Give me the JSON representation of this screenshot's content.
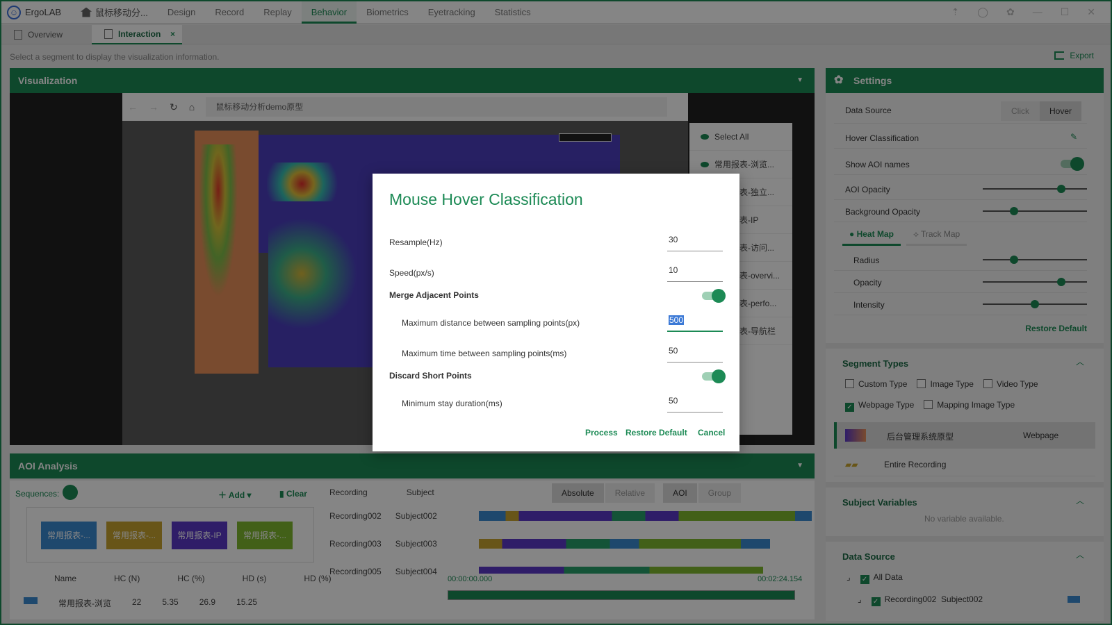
{
  "app": {
    "name": "ErgoLAB",
    "project": "鼠标移动分..."
  },
  "nav": [
    "Design",
    "Record",
    "Replay",
    "Behavior",
    "Biometrics",
    "Eyetracking",
    "Statistics"
  ],
  "subtabs": {
    "overview": "Overview",
    "interaction": "Interaction",
    "close": "×"
  },
  "hint": "Select a segment to display the visualization information.",
  "export": "Export",
  "visualization": {
    "title": "Visualization",
    "browser_url": "鼠标移动分析demo原型",
    "segments": [
      "Select All",
      "常用报表-浏览...",
      "常用报表-独立...",
      "常用报表-IP",
      "常用报表-访问...",
      "常用报表-overvi...",
      "常用报表-perfo...",
      "常用报表-导航栏"
    ]
  },
  "aoi": {
    "title": "AOI Analysis",
    "sequences": "Sequences:",
    "add": "Add",
    "clear": "Clear",
    "seq_items": [
      "常用报表-...",
      "常用报表-...",
      "常用报表-IP",
      "常用报表-..."
    ],
    "columns": [
      "Name",
      "HC (N)",
      "HC (%)",
      "HD (s)",
      "HD (%)"
    ],
    "row": [
      "常用报表-浏览",
      "22",
      "5.35",
      "26.9",
      "15.25"
    ],
    "rec_headers": [
      "Recording",
      "Subject"
    ],
    "modes": [
      "Absolute",
      "Relative",
      "AOI",
      "Group"
    ],
    "recordings": [
      [
        "Recording002",
        "Subject002"
      ],
      [
        "Recording003",
        "Subject003"
      ],
      [
        "Recording005",
        "Subject004"
      ]
    ],
    "time_start": "00:00:00.000",
    "time_end": "00:02:24.154"
  },
  "settings": {
    "title": "Settings",
    "data_source": "Data Source",
    "click": "Click",
    "hover": "Hover",
    "hover_class": "Hover Classification",
    "show_aoi": "Show AOI names",
    "aoi_opacity": "AOI Opacity",
    "aoi_opacity_value": 0.75,
    "bg_opacity": "Background Opacity",
    "bg_opacity_value": 0.3,
    "heat_map": "Heat Map",
    "track_map": "Track Map",
    "radius": "Radius",
    "radius_value": 0.3,
    "opacity": "Opacity",
    "opacity_value": 0.75,
    "intensity": "Intensity",
    "intensity_value": 0.5,
    "restore": "Restore Default",
    "segment_types": "Segment Types",
    "types": [
      "Custom Type",
      "Image Type",
      "Video Type",
      "Webpage Type",
      "Mapping Image Type"
    ],
    "seg_row1": [
      "后台管理系统原型",
      "Webpage"
    ],
    "seg_row2": "Entire Recording",
    "subject_vars": "Subject Variables",
    "no_var": "No variable available.",
    "ds_title": "Data Source",
    "all_data": "All Data",
    "rec_row": [
      "Recording002",
      "Subject002"
    ]
  },
  "modal": {
    "title": "Mouse Hover Classification",
    "resample": "Resample(Hz)",
    "resample_val": "30",
    "speed": "Speed(px/s)",
    "speed_val": "10",
    "merge": "Merge Adjacent Points",
    "maxdist": "Maximum distance between sampling points(px)",
    "maxdist_val": "500",
    "maxtime": "Maximum time between sampling points(ms)",
    "maxtime_val": "50",
    "discard": "Discard Short Points",
    "minstay": "Minimum stay duration(ms)",
    "minstay_val": "50",
    "process": "Process",
    "restore": "Restore Default",
    "cancel": "Cancel"
  },
  "colors": {
    "accent": "#1c8a55",
    "heat_bg": "#4b3fbf"
  }
}
